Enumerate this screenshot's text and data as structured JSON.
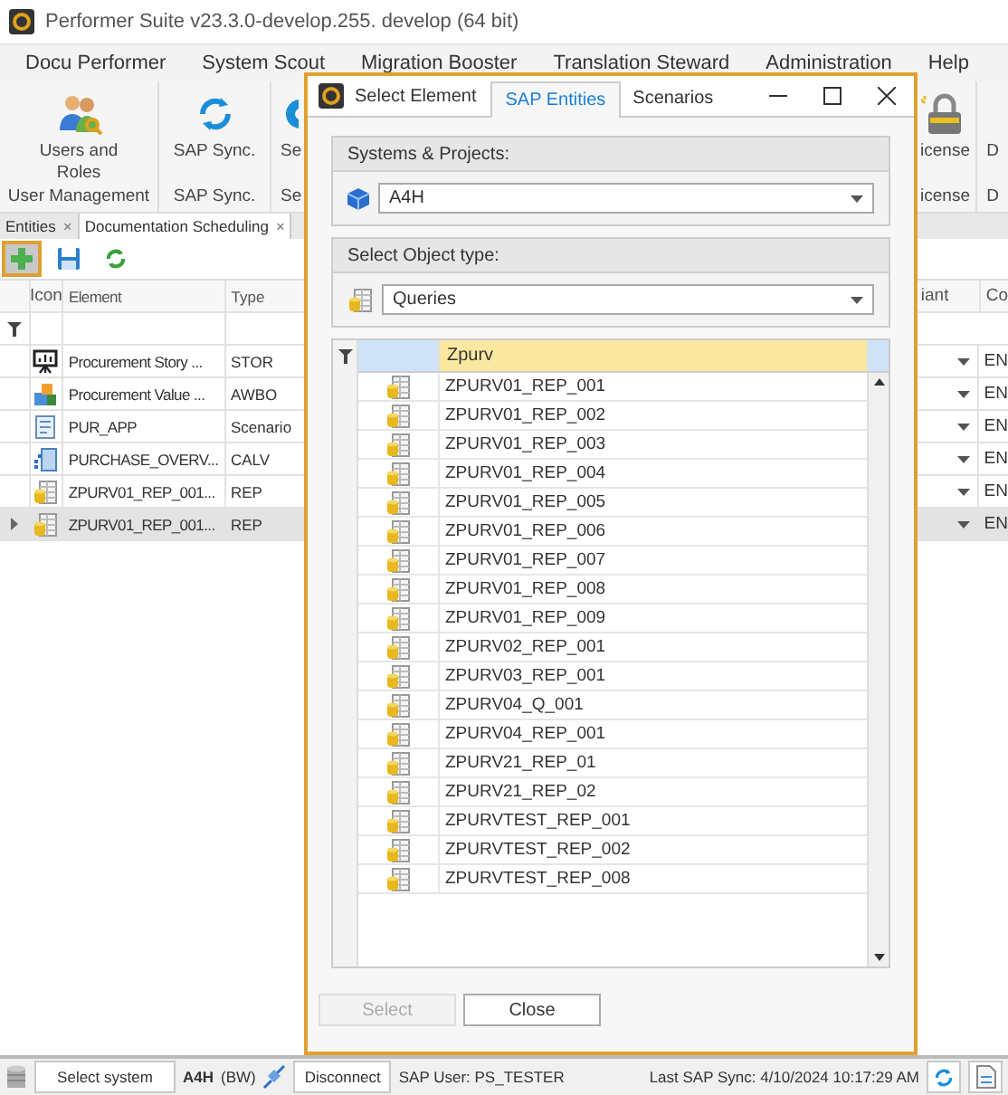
{
  "window": {
    "title": "Performer Suite v23.3.0-develop.255. develop (64 bit)"
  },
  "menu": [
    "Docu Performer",
    "System Scout",
    "Migration Booster",
    "Translation Steward",
    "Administration",
    "Help"
  ],
  "ribbon": {
    "groups": [
      {
        "kind": "users",
        "label": "Users and Roles",
        "caption": "User Management"
      },
      {
        "kind": "sync",
        "label": "SAP Sync.",
        "caption": "SAP Sync."
      },
      {
        "kind": "gear",
        "label": "Se",
        "caption": "Se"
      },
      {
        "kind": "gap"
      },
      {
        "kind": "license",
        "label": "icense",
        "caption": "icense"
      },
      {
        "kind": "text",
        "label": "D",
        "caption": "D"
      }
    ]
  },
  "doc_tabs": [
    {
      "label": "Entities",
      "close": "×",
      "selected": false
    },
    {
      "label": "Documentation Scheduling",
      "close": "×",
      "selected": true
    }
  ],
  "toolbar": [
    {
      "kind": "add",
      "selected": true
    },
    {
      "kind": "save",
      "selected": false
    },
    {
      "kind": "refresh",
      "selected": false
    }
  ],
  "grid": {
    "columns": [
      "Icon",
      "Element",
      "Type",
      "iant",
      "Co"
    ],
    "rows": [
      {
        "kind": "story",
        "element": "Procurement Story ...",
        "type": "STOR",
        "column_5": "EN",
        "selected": false
      },
      {
        "kind": "awbo",
        "element": "Procurement Value ...",
        "type": "AWBO",
        "column_5": "EN",
        "selected": false
      },
      {
        "kind": "scenario",
        "element": "PUR_APP",
        "type": "Scenario",
        "column_5": "EN",
        "selected": false
      },
      {
        "kind": "calv",
        "element": "PURCHASE_OVERV...",
        "type": "CALV",
        "column_5": "EN",
        "selected": false
      },
      {
        "kind": "query",
        "element": "ZPURV01_REP_001...",
        "type": "REP",
        "column_5": "EN",
        "selected": false
      },
      {
        "kind": "query",
        "element": "ZPURV01_REP_001...",
        "type": "REP",
        "column_5": "EN",
        "selected": true
      }
    ]
  },
  "dialog": {
    "title": "Select Element",
    "tabs": [
      {
        "label": "SAP Entities",
        "selected": true
      },
      {
        "label": "Scenarios",
        "selected": false
      }
    ],
    "systems": {
      "label": "Systems & Projects:",
      "value": "A4H"
    },
    "object_type": {
      "label": "Select Object type:",
      "value": "Queries"
    },
    "results": {
      "filter": "Zpurv",
      "rows": [
        "ZPURV01_REP_001",
        "ZPURV01_REP_002",
        "ZPURV01_REP_003",
        "ZPURV01_REP_004",
        "ZPURV01_REP_005",
        "ZPURV01_REP_006",
        "ZPURV01_REP_007",
        "ZPURV01_REP_008",
        "ZPURV01_REP_009",
        "ZPURV02_REP_001",
        "ZPURV03_REP_001",
        "ZPURV04_Q_001",
        "ZPURV04_REP_001",
        "ZPURV21_REP_01",
        "ZPURV21_REP_02",
        "ZPURVTEST_REP_001",
        "ZPURVTEST_REP_002",
        "ZPURVTEST_REP_008"
      ]
    },
    "buttons": [
      {
        "label": "Select",
        "disabled": true
      },
      {
        "label": "Close",
        "disabled": false
      }
    ]
  },
  "status_bar": {
    "select_system": "Select system",
    "system": "A4H",
    "system_type": "(BW)",
    "disconnect": "Disconnect",
    "user": "SAP User: PS_TESTER",
    "last_sync": "Last SAP Sync: 4/10/2024 10:17:29 AM"
  }
}
